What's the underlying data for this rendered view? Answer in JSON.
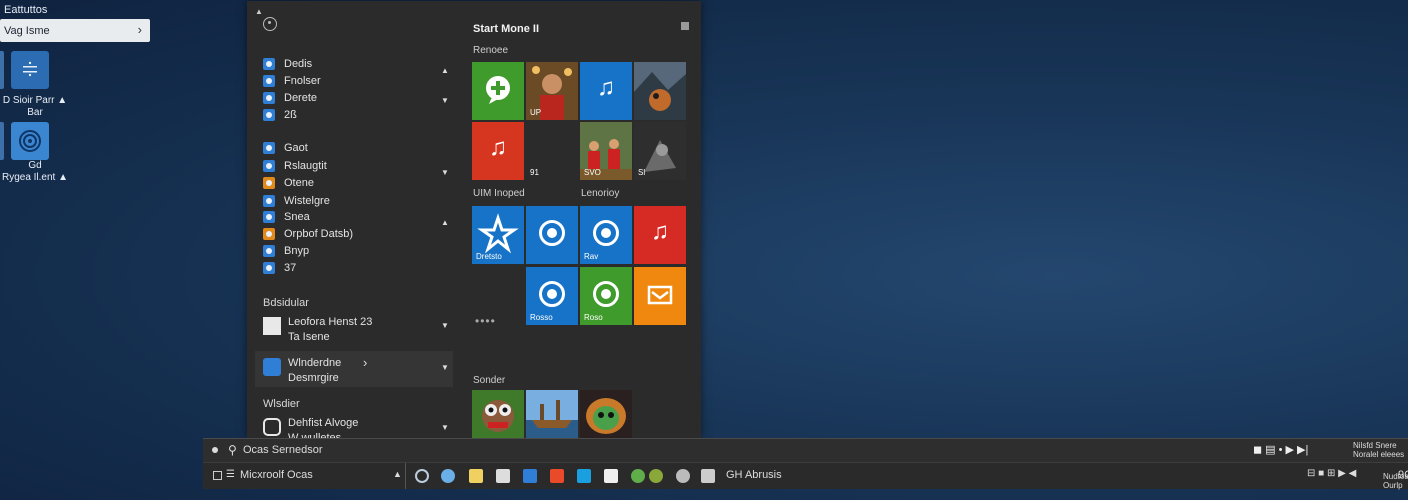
{
  "desktop": {
    "label": "Eattuttos",
    "pill_label": "Vag Isme",
    "pill_chevron": "›",
    "icons": [
      {
        "caption_line1": "D Sioir Parr ▲",
        "caption_line2": "Bar"
      },
      {
        "caption_line1": "Gd",
        "caption_line2": "Rygea Il.ent ▲"
      }
    ]
  },
  "start_menu": {
    "header_caret": "▲",
    "apps": [
      {
        "label": "Dedis",
        "icon": "blue",
        "caret": "▲"
      },
      {
        "label": "Fnolser",
        "icon": "blue",
        "caret": ""
      },
      {
        "label": "Derete",
        "icon": "blue",
        "caret": "▼"
      },
      {
        "label": "2ß",
        "icon": "blue",
        "caret": ""
      },
      {
        "label": "Gaot",
        "icon": "blue",
        "caret": ""
      },
      {
        "label": "Rslaugtit",
        "icon": "blue",
        "caret": ""
      },
      {
        "label": "Otene",
        "icon": "orange",
        "caret": "▼"
      },
      {
        "label": "Wistelgre",
        "icon": "blue",
        "caret": ""
      },
      {
        "label": "Snea",
        "icon": "blue",
        "caret": "▲"
      },
      {
        "label": "Orpbof Datsb)",
        "icon": "orange",
        "caret": ""
      },
      {
        "label": "Bnyp",
        "icon": "blue",
        "caret": ""
      },
      {
        "label": "37",
        "icon": "blue",
        "caret": ""
      }
    ],
    "section1": "Bdsidular",
    "big_app1": {
      "line1": "Leofora Henst 23",
      "line2": "Ta Isene",
      "caret": "▼"
    },
    "big_app2": {
      "line1": "Wlnderdne",
      "line2": "Desmrgire",
      "arrow": "›",
      "caret": "▼"
    },
    "section2": "Wlsdier",
    "big_app3": {
      "line1": "Dehfist Alvoge",
      "line2": "W wulletes",
      "caret": "▼"
    },
    "tiles_title": "Start Mone II",
    "group1": "Renoee",
    "group2a": "UIM Inoped",
    "group2b": "Lenorioy",
    "group3": "Sonder",
    "tile_labels": {
      "t1": "",
      "t2": "UP",
      "t3": "",
      "t4": "",
      "t5": "",
      "t6": "91",
      "t7": "SVO",
      "t8": "Sl",
      "t9": "Dretsto",
      "t10": "",
      "t11": "Rav",
      "t12": "",
      "t13": "Rosso",
      "t14": "Roso",
      "t15": ""
    },
    "more_dots": "••••"
  },
  "taskbar": {
    "search_text": "Ocas Sernedsor",
    "start_label": "Micxroolf Ocas",
    "expand_caret": "▲",
    "pinned_label": "GH Abrusis",
    "tray_top_line1": "Nilsfd Snere",
    "tray_top_line2": "Noralel eleees",
    "tray_bottom": "Nudtoa Ourlp",
    "time": "9C"
  },
  "colors": {
    "desktop_bg": "#183557",
    "start_bg": "#2b2b2b",
    "tile_green": "#3f9b2c",
    "tile_blue": "#1673c7",
    "tile_red": "#d6351f",
    "tile_orange": "#f0880f",
    "taskbar_bg": "#2a2a2a"
  }
}
